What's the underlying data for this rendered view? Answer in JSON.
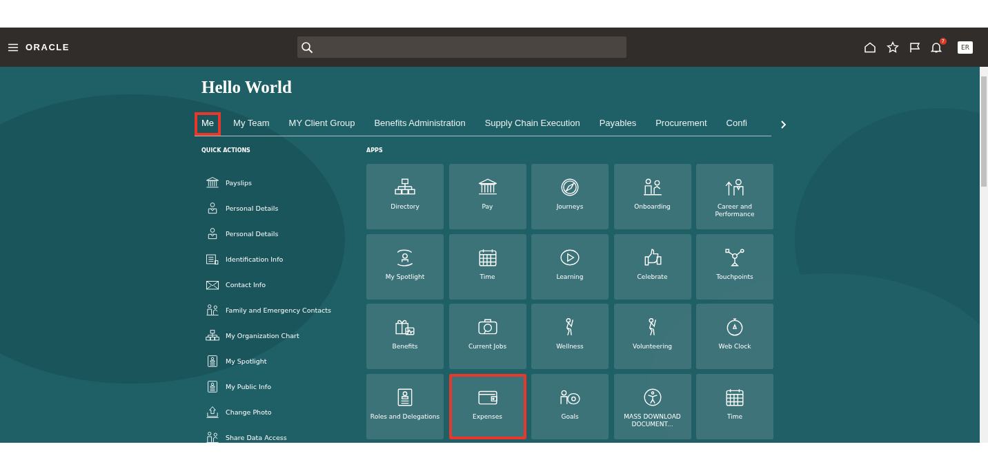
{
  "header": {
    "logo": "ORACLE",
    "notification_count": "7",
    "avatar_initials": "ER"
  },
  "greeting": "Hello World",
  "tabs": [
    {
      "label": "Me",
      "selected": true,
      "highlighted": true
    },
    {
      "label": "My Team",
      "selected": false,
      "highlighted": false
    },
    {
      "label": "MY Client Group",
      "selected": false,
      "highlighted": false
    },
    {
      "label": "Benefits Administration",
      "selected": false,
      "highlighted": false
    },
    {
      "label": "Supply Chain Execution",
      "selected": false,
      "highlighted": false
    },
    {
      "label": "Payables",
      "selected": false,
      "highlighted": false
    },
    {
      "label": "Procurement",
      "selected": false,
      "highlighted": false
    },
    {
      "label": "Confi",
      "selected": false,
      "highlighted": false
    }
  ],
  "quick_actions": {
    "heading": "QUICK ACTIONS",
    "items": [
      {
        "label": "Payslips"
      },
      {
        "label": "Personal Details"
      },
      {
        "label": "Personal Details"
      },
      {
        "label": "Identification Info"
      },
      {
        "label": "Contact Info"
      },
      {
        "label": "Family and Emergency Contacts"
      },
      {
        "label": "My Organization Chart"
      },
      {
        "label": "My Spotlight"
      },
      {
        "label": "My Public Info"
      },
      {
        "label": "Change Photo"
      },
      {
        "label": "Share Data Access"
      }
    ]
  },
  "apps": {
    "heading": "APPS",
    "tiles": [
      {
        "label": "Directory",
        "highlighted": false
      },
      {
        "label": "Pay",
        "highlighted": false
      },
      {
        "label": "Journeys",
        "highlighted": false
      },
      {
        "label": "Onboarding",
        "highlighted": false
      },
      {
        "label": "Career and Performance",
        "highlighted": false
      },
      {
        "label": "My Spotlight",
        "highlighted": false
      },
      {
        "label": "Time",
        "highlighted": false
      },
      {
        "label": "Learning",
        "highlighted": false
      },
      {
        "label": "Celebrate",
        "highlighted": false
      },
      {
        "label": "Touchpoints",
        "highlighted": false
      },
      {
        "label": "Benefits",
        "highlighted": false
      },
      {
        "label": "Current Jobs",
        "highlighted": false
      },
      {
        "label": "Wellness",
        "highlighted": false
      },
      {
        "label": "Volunteering",
        "highlighted": false
      },
      {
        "label": "Web Clock",
        "highlighted": false
      },
      {
        "label": "Roles and Delegations",
        "highlighted": false
      },
      {
        "label": "Expenses",
        "highlighted": true
      },
      {
        "label": "Goals",
        "highlighted": false
      },
      {
        "label": "MASS DOWNLOAD DOCUMENT...",
        "highlighted": false
      },
      {
        "label": "Time",
        "highlighted": false
      }
    ]
  }
}
